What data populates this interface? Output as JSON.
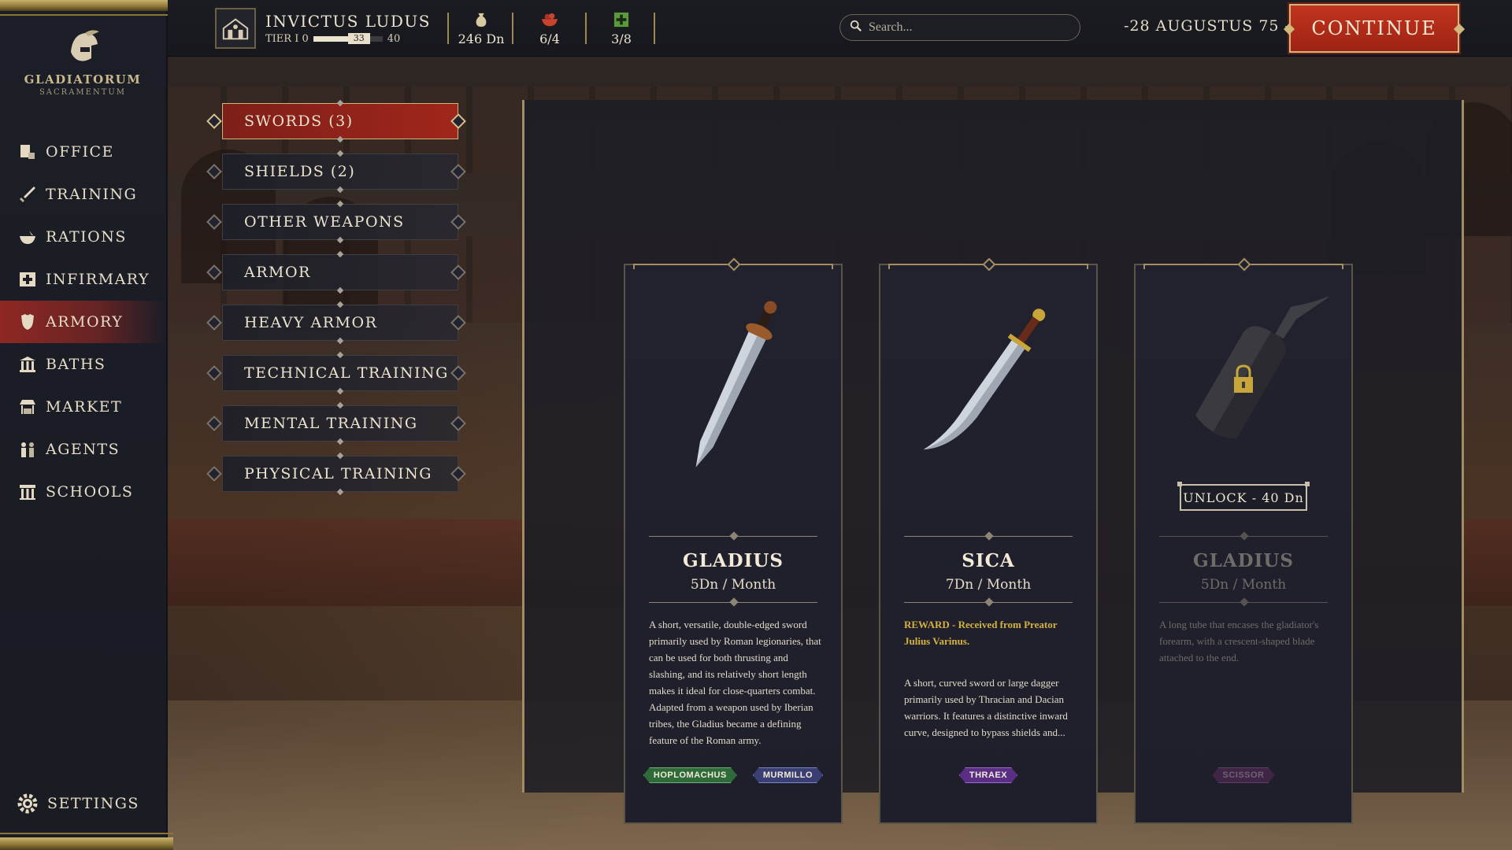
{
  "brand": {
    "title": "GLADIATORUM",
    "subtitle": "SACRAMENTUM",
    "icon": "gladiator-helmet-icon"
  },
  "nav": {
    "items": [
      {
        "label": "OFFICE",
        "icon": "desk-icon"
      },
      {
        "label": "TRAINING",
        "icon": "sword-icon"
      },
      {
        "label": "RATIONS",
        "icon": "bowl-icon"
      },
      {
        "label": "INFIRMARY",
        "icon": "medical-cross-icon"
      },
      {
        "label": "ARMORY",
        "icon": "armor-icon"
      },
      {
        "label": "BATHS",
        "icon": "temple-icon"
      },
      {
        "label": "MARKET",
        "icon": "stall-icon"
      },
      {
        "label": "AGENTS",
        "icon": "agents-icon"
      },
      {
        "label": "SCHOOLS",
        "icon": "school-icon"
      }
    ],
    "active": "ARMORY",
    "settings_label": "SETTINGS"
  },
  "header": {
    "ludus_name": "INVICTUS LUDUS",
    "tier_label": "TIER I",
    "tier_min": "0",
    "tier_value": "33",
    "tier_max": "40",
    "tier_progress": 0.825,
    "money": "246 Dn",
    "rations": "6/4",
    "capacity": "3/8",
    "search_placeholder": "Search...",
    "date": "-28 AUGUSTUS 75 -",
    "continue_label": "CONTINUE"
  },
  "categories": [
    {
      "label": "SWORDS (3)",
      "active": true
    },
    {
      "label": "SHIELDS (2)"
    },
    {
      "label": "OTHER WEAPONS"
    },
    {
      "label": "ARMOR"
    },
    {
      "label": "HEAVY ARMOR"
    },
    {
      "label": "TECHNICAL TRAINING"
    },
    {
      "label": "MENTAL TRAINING"
    },
    {
      "label": "PHYSICAL TRAINING"
    }
  ],
  "cards": [
    {
      "name": "GLADIUS",
      "price": "5Dn / Month",
      "reward": "",
      "description": "A short, versatile, double-edged sword primarily used by Roman legionaries, that can be used for both thrusting and slashing, and its relatively short length makes it ideal for close-quarters combat. Adapted from a weapon used by Iberian tribes, the Gladius became a defining feature of the Roman army.",
      "tags": [
        "HOPLOMACHUS",
        "MURMILLO"
      ],
      "locked": false
    },
    {
      "name": "SICA",
      "price": "7Dn / Month",
      "reward": "REWARD - Received  from Preator Julius Varinus.",
      "description": "A short, curved sword or large dagger primarily used by Thracian and Dacian warriors. It features a distinctive inward curve, designed to bypass shields and...",
      "tags": [
        "THRAEX"
      ],
      "locked": false
    },
    {
      "name": "GLADIUS",
      "price": "5Dn / Month",
      "reward": "",
      "description": "A long tube that encases the gladiator's forearm, with a crescent-shaped blade attached to the end.",
      "tags": [
        "SCISSOR"
      ],
      "locked": true,
      "unlock_label": "UNLOCK - 40 Dn"
    }
  ],
  "tag_colors": {
    "HOPLOMACHUS": "#2f6b3a",
    "MURMILLO": "#3a3f73",
    "THRAEX": "#5b2e86",
    "SCISSOR": "#6a2d6b"
  },
  "colors": {
    "accent_red": "#a0261a",
    "gold": "#c9b26d"
  }
}
